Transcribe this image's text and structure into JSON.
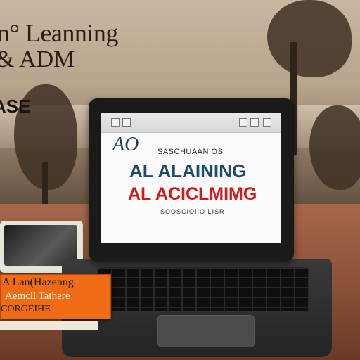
{
  "overlay": {
    "title_line_1": "n° Leanning",
    "title_line_2": "& ADM",
    "title_line_3": "ASE"
  },
  "screen": {
    "logo": "AO",
    "subtitle": "SASCHUAAN OS",
    "headline_1": "AL ALAINING",
    "headline_2": "AL ACICLMIMG",
    "footer": "SOOSCIOIIO LISR"
  },
  "note": {
    "line_1": "A Lan(Hazenng",
    "line_2": "Aemcll Tathere",
    "line_3": "CORGEIHE"
  },
  "colors": {
    "headline_blue": "#1e4b66",
    "headline_red": "#d11a1a",
    "note_orange": "#ef6b16"
  }
}
